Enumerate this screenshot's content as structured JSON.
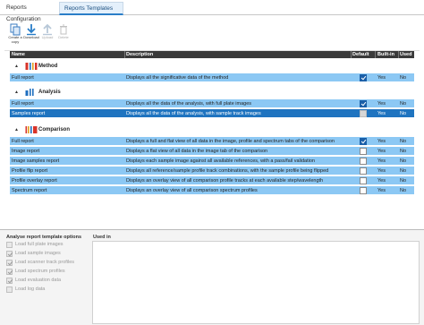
{
  "tabs": [
    {
      "label": "Reports Configuration"
    },
    {
      "label": "Reports Templates"
    }
  ],
  "toolbar": {
    "create_label": "Create a copy",
    "download_label": "Download",
    "upload_label": "Upload",
    "delete_label": "Delete"
  },
  "grid": {
    "columns": {
      "name": "Name",
      "description": "Description",
      "default": "Default",
      "built_in": "Built-in",
      "used": "Used"
    },
    "groups": [
      {
        "name": "Method",
        "icon": "method-icon",
        "rows": [
          {
            "name": "Full report",
            "description": "Displays all the significative data of the method",
            "default": true,
            "built_in": "Yes",
            "used": "No",
            "selected": false
          }
        ]
      },
      {
        "name": "Analysis",
        "icon": "analysis-icon",
        "rows": [
          {
            "name": "Full report",
            "description": "Displays all the data of the analysis, with full plate images",
            "default": true,
            "built_in": "Yes",
            "used": "No",
            "selected": false
          },
          {
            "name": "Samples report",
            "description": "Displays all the data of the analysis, with sample track images",
            "default": false,
            "built_in": "Yes",
            "used": "No",
            "selected": true
          }
        ]
      },
      {
        "name": "Comparison",
        "icon": "comparison-icon",
        "rows": [
          {
            "name": "Full report",
            "description": "Displays a full and flat view of all data in the image, profile and spectrum tabs of the comparison",
            "default": true,
            "built_in": "Yes",
            "used": "No",
            "selected": false
          },
          {
            "name": "Image report",
            "description": "Displays a flat view of all data in the image tab of the comparison",
            "default": false,
            "built_in": "Yes",
            "used": "No",
            "selected": false
          },
          {
            "name": "Image samples report",
            "description": "Displays each sample image against all available references, with a pass/fail validation",
            "default": false,
            "built_in": "Yes",
            "used": "No",
            "selected": false
          },
          {
            "name": "Profile flip report",
            "description": "Displays all reference/sample profile track combinations, with the sample profile being flipped",
            "default": false,
            "built_in": "Yes",
            "used": "No",
            "selected": false
          },
          {
            "name": "Profile overlay report",
            "description": "Displays an overlay view of all comparison profile tracks at each available step/wavelength",
            "default": false,
            "built_in": "Yes",
            "used": "No",
            "selected": false
          },
          {
            "name": "Spectrum report",
            "description": "Displays an overlay view of all comparison spectrum profiles",
            "default": false,
            "built_in": "Yes",
            "used": "No",
            "selected": false
          }
        ]
      }
    ]
  },
  "options": {
    "title": "Analyse report template options",
    "items": [
      {
        "label": "Load full plate images",
        "checked": false
      },
      {
        "label": "Load sample images",
        "checked": true
      },
      {
        "label": "Load scanner track profiles",
        "checked": true
      },
      {
        "label": "Load spectrum profiles",
        "checked": true
      },
      {
        "label": "Load evaluation data",
        "checked": true
      },
      {
        "label": "Load log data",
        "checked": false
      }
    ]
  },
  "used_in": {
    "title": "Used in"
  },
  "colors": {
    "row": "#8cc8f4",
    "selected_row": "#1f74c0",
    "header": "#3a3a3a",
    "accent": "#2a7ec8"
  }
}
